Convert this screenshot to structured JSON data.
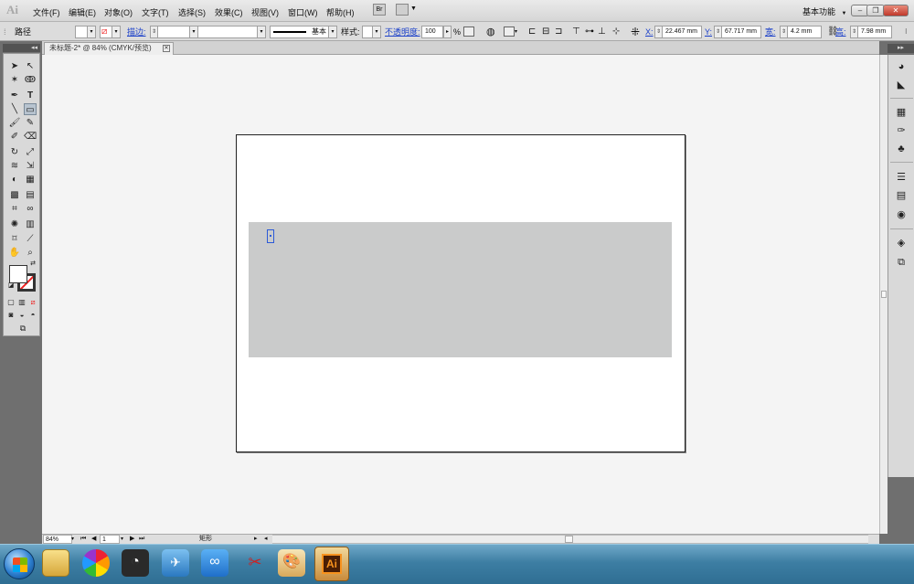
{
  "app": {
    "logo_text": "Ai"
  },
  "menu": [
    {
      "label": "文件(F)"
    },
    {
      "label": "编辑(E)"
    },
    {
      "label": "对象(O)"
    },
    {
      "label": "文字(T)"
    },
    {
      "label": "选择(S)"
    },
    {
      "label": "效果(C)"
    },
    {
      "label": "视图(V)"
    },
    {
      "label": "窗口(W)"
    },
    {
      "label": "帮助(H)"
    }
  ],
  "menubar_buttons": {
    "bridge_icon": "Br",
    "arrange_icon": "arrange-docs-icon"
  },
  "workspace": {
    "label": "基本功能",
    "chevron": "▼"
  },
  "window_controls": {
    "minimize": "‒",
    "restore": "❐",
    "close": "✕"
  },
  "control_bar": {
    "selection_label": "路径",
    "stroke_label": "描边:",
    "stroke_value": "",
    "variable_width_value": "",
    "brush_label": "基本",
    "style_label": "样式:",
    "opacity_label": "不透明度:",
    "opacity_value": "100",
    "opacity_unit": "%",
    "x_label": "X:",
    "x_value": "22.467 mm",
    "y_label": "Y:",
    "y_value": "67.717 mm",
    "w_label": "宽:",
    "w_value": "4.2 mm",
    "h_label": "高:",
    "h_value": "7.98 mm"
  },
  "document": {
    "tab_title": "未标题-2* @ 84% (CMYK/预览)",
    "close": "✕"
  },
  "colors": {
    "canvas_bg": "#f4f4f4",
    "rect_fill": "#cacbcb",
    "selection": "#2b5ad8",
    "no_stroke_slash": "#e22222"
  },
  "tools": {
    "selection": "➤",
    "direct_selection": "↖",
    "magic_wand": "✶",
    "lasso": "ↂ",
    "pen": "✒",
    "type": "T",
    "line": "╲",
    "rectangle": "▭",
    "paintbrush": "🖌",
    "pencil": "✎",
    "blob_brush": "✐",
    "eraser": "⌫",
    "rotate": "↻",
    "scale": "⤢",
    "warp": "≋",
    "free_transform": "⇲",
    "shape_builder": "◐",
    "perspective": "▦",
    "mesh": "▩",
    "gradient": "▤",
    "eyedropper": "⌗",
    "blend": "∞",
    "symbol_sprayer": "✺",
    "column_graph": "▥",
    "artboard": "⌑",
    "slice": "⟋",
    "hand": "✋",
    "zoom": "⌕"
  },
  "dock": {
    "collapse": "◂◂",
    "expand": "▸▸"
  },
  "statusbar": {
    "zoom": "84%",
    "artboard_number": "1",
    "tool_name": "矩形",
    "nav_first": "⏮",
    "nav_prev": "◀",
    "nav_next": "▶",
    "nav_last": "⏭"
  },
  "taskbar": {
    "illustrator_label": "Ai",
    "apps": [
      "windows-explorer",
      "picasa",
      "wifi-manager",
      "lite-app",
      "cloud-sync",
      "scissors-tool",
      "paint-palette",
      "illustrator"
    ]
  }
}
